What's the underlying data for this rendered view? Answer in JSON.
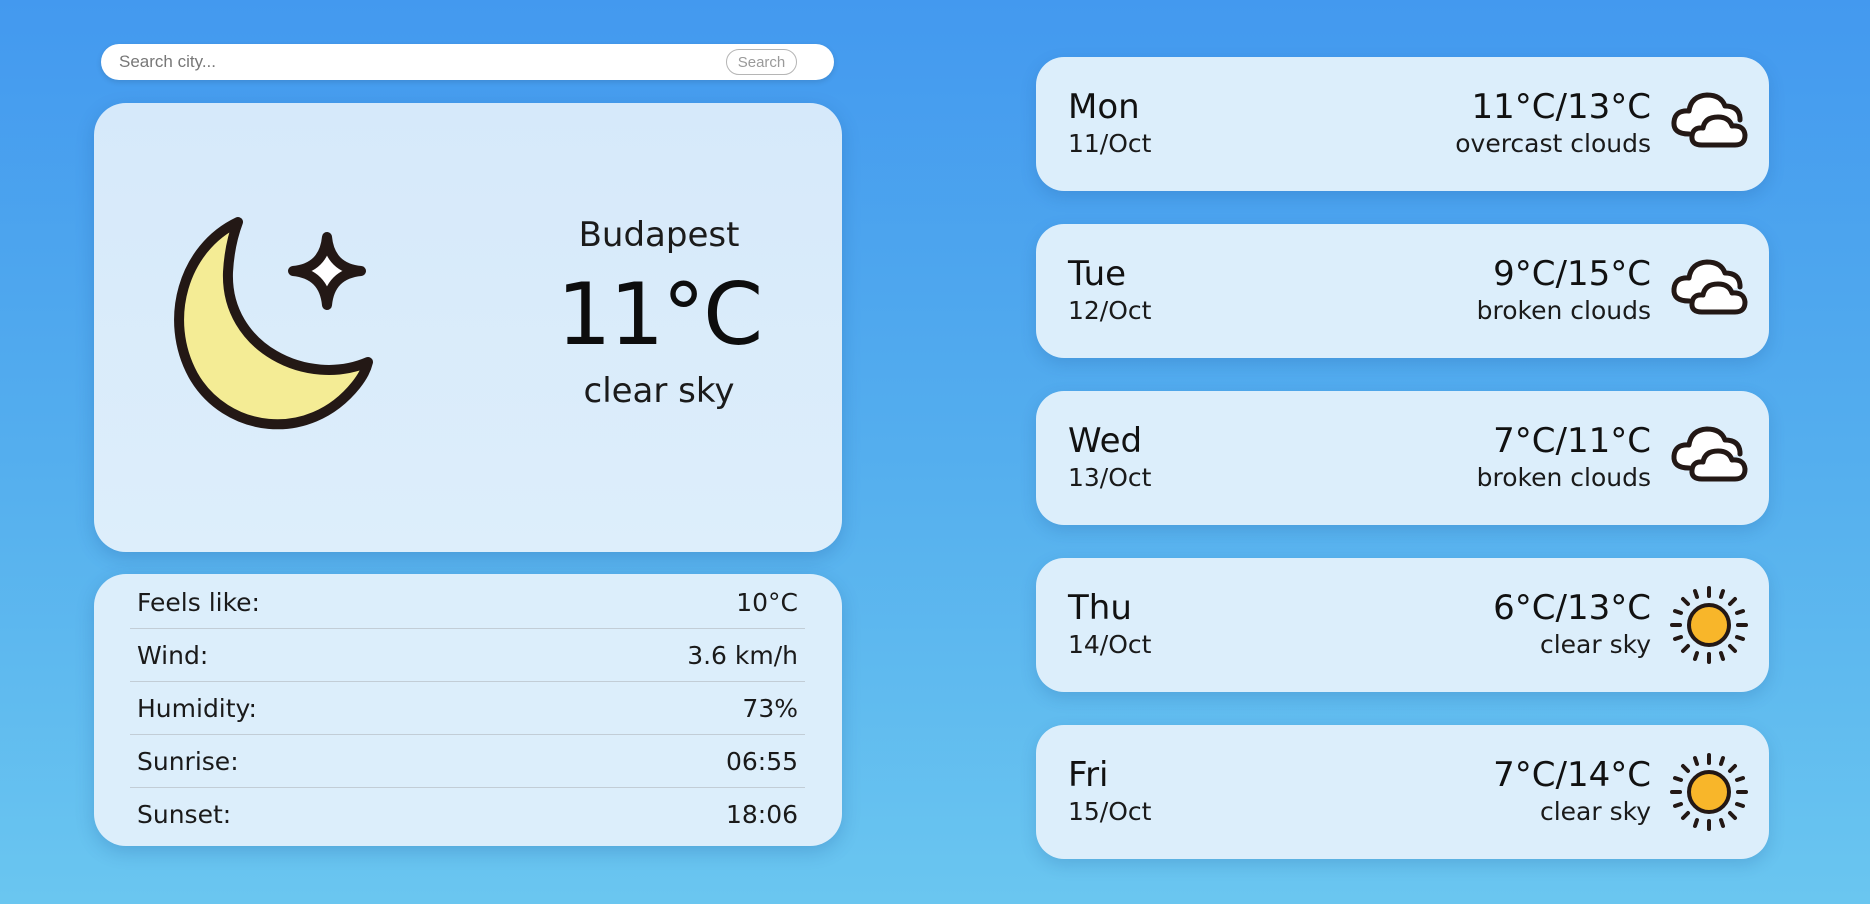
{
  "search": {
    "placeholder": "Search city...",
    "button_label": "Search"
  },
  "current": {
    "city": "Budapest",
    "temperature": "11°C",
    "description": "clear sky",
    "icon": "moon-stars-icon"
  },
  "details": [
    {
      "label": "Feels like:",
      "value": "10°C"
    },
    {
      "label": "Wind:",
      "value": "3.6 km/h"
    },
    {
      "label": "Humidity:",
      "value": "73%"
    },
    {
      "label": "Sunrise:",
      "value": "06:55"
    },
    {
      "label": "Sunset:",
      "value": "18:06"
    }
  ],
  "forecast": [
    {
      "day": "Mon",
      "date": "11/Oct",
      "temp": "11°C/13°C",
      "description": "overcast clouds",
      "icon": "clouds-icon"
    },
    {
      "day": "Tue",
      "date": "12/Oct",
      "temp": "9°C/15°C",
      "description": "broken clouds",
      "icon": "clouds-icon"
    },
    {
      "day": "Wed",
      "date": "13/Oct",
      "temp": "7°C/11°C",
      "description": "broken clouds",
      "icon": "clouds-icon"
    },
    {
      "day": "Thu",
      "date": "14/Oct",
      "temp": "6°C/13°C",
      "description": "clear sky",
      "icon": "sun-icon"
    },
    {
      "day": "Fri",
      "date": "15/Oct",
      "temp": "7°C/14°C",
      "description": "clear sky",
      "icon": "sun-icon"
    }
  ],
  "colors": {
    "background_top": "#4399ef",
    "background_bottom": "#6ac6f0",
    "card": "#dceefb",
    "moon_fill": "#f4ec95",
    "sun_fill": "#f8b62a",
    "outline": "#231815"
  }
}
